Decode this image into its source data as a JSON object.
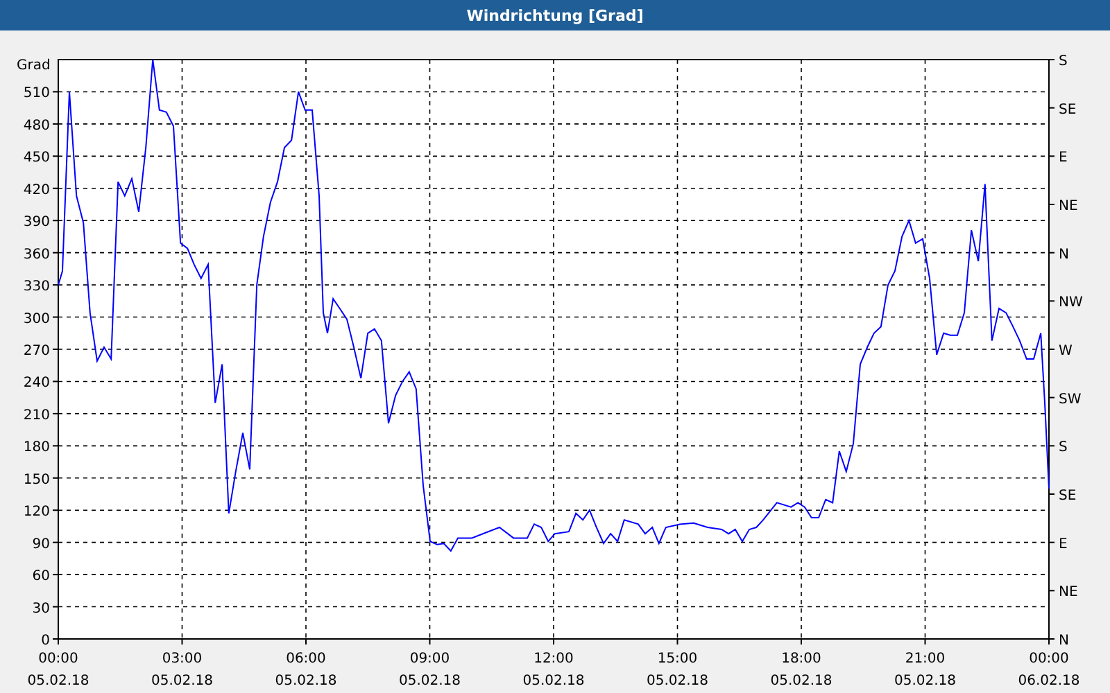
{
  "window": {
    "title": "Windrichtung [Grad]"
  },
  "chart": {
    "chart_data": {
      "type": "line",
      "grid": true,
      "ylabel": "Grad",
      "xlim": [
        0,
        24
      ],
      "ylim": [
        0,
        540
      ],
      "yticks": [
        0,
        30,
        60,
        90,
        120,
        150,
        180,
        210,
        240,
        270,
        300,
        330,
        360,
        390,
        420,
        450,
        480,
        510
      ],
      "xticks": [
        {
          "value": 0,
          "label": "00:00"
        },
        {
          "value": 3,
          "label": "03:00"
        },
        {
          "value": 6,
          "label": "06:00"
        },
        {
          "value": 9,
          "label": "09:00"
        },
        {
          "value": 12,
          "label": "12:00"
        },
        {
          "value": 15,
          "label": "15:00"
        },
        {
          "value": 18,
          "label": "18:00"
        },
        {
          "value": 21,
          "label": "21:00"
        },
        {
          "value": 24,
          "label": "00:00"
        }
      ],
      "x": [
        0,
        0.1,
        0.27,
        0.44,
        0.61,
        0.77,
        0.94,
        1.11,
        1.28,
        1.45,
        1.61,
        1.78,
        1.95,
        2.12,
        2.29,
        2.45,
        2.62,
        2.79,
        2.96,
        3.13,
        3.29,
        3.46,
        3.63,
        3.8,
        3.97,
        4.13,
        4.3,
        4.47,
        4.64,
        4.81,
        4.97,
        5.14,
        5.31,
        5.48,
        5.65,
        5.82,
        5.98,
        6.15,
        6.32,
        6.42,
        6.52,
        6.66,
        6.82,
        6.99,
        7.16,
        7.33,
        7.5,
        7.66,
        7.83,
        8,
        8.17,
        8.34,
        8.5,
        8.67,
        8.84,
        9.01,
        9.18,
        9.34,
        9.51,
        9.68,
        10.02,
        10.35,
        10.69,
        11.03,
        11.36,
        11.53,
        11.7,
        11.87,
        12.03,
        12.37,
        12.54,
        12.71,
        12.87,
        13.04,
        13.21,
        13.38,
        13.55,
        13.71,
        14.05,
        14.22,
        14.39,
        14.55,
        14.72,
        15.06,
        15.39,
        15.73,
        16.07,
        16.24,
        16.4,
        16.57,
        16.74,
        16.91,
        17.08,
        17.41,
        17.75,
        17.92,
        18.08,
        18.25,
        18.42,
        18.59,
        18.76,
        18.92,
        19.09,
        19.26,
        19.43,
        19.6,
        19.76,
        19.93,
        20.1,
        20.27,
        20.44,
        20.61,
        20.77,
        20.94,
        21.11,
        21.28,
        21.45,
        21.61,
        21.78,
        21.95,
        22.12,
        22.29,
        22.45,
        22.62,
        22.79,
        22.96,
        23.13,
        23.29,
        23.46,
        23.63,
        23.8,
        23.9,
        24
      ],
      "series": [
        {
          "color": "#0000ff",
          "values": [
            330,
            343,
            510,
            413,
            388,
            304,
            259,
            272,
            261,
            426,
            413,
            429,
            398,
            458,
            540,
            493,
            491,
            478,
            369,
            364,
            349,
            336,
            349,
            220,
            256,
            117,
            156,
            192,
            158,
            330,
            375,
            407,
            426,
            458,
            465,
            510,
            493,
            493,
            413,
            304,
            285,
            317,
            308,
            298,
            272,
            243,
            285,
            289,
            278,
            201,
            227,
            240,
            249,
            233,
            143,
            91,
            88,
            89,
            82,
            94,
            94,
            99,
            104,
            94,
            94,
            107,
            104,
            91,
            98,
            100,
            117,
            111,
            120,
            104,
            89,
            98,
            91,
            111,
            107,
            98,
            104,
            89,
            104,
            107,
            108,
            104,
            102,
            98,
            102,
            91,
            102,
            104,
            111,
            127,
            123,
            127,
            123,
            113,
            113,
            130,
            127,
            175,
            156,
            182,
            256,
            272,
            285,
            291,
            330,
            343,
            375,
            390,
            369,
            373,
            336,
            265,
            285,
            283,
            283,
            304,
            381,
            352,
            424,
            278,
            308,
            304,
            291,
            278,
            261,
            261,
            285,
            220,
            140
          ]
        }
      ]
    },
    "date_labels": [
      "05.02.18",
      "05.02.18",
      "05.02.18",
      "05.02.18",
      "05.02.18",
      "05.02.18",
      "05.02.18",
      "05.02.18",
      "06.02.18"
    ],
    "compass_ticks": [
      "S",
      "SE",
      "E",
      "NE",
      "N",
      "NW",
      "W",
      "SW",
      "S",
      "SE",
      "E",
      "NE",
      "N"
    ]
  }
}
